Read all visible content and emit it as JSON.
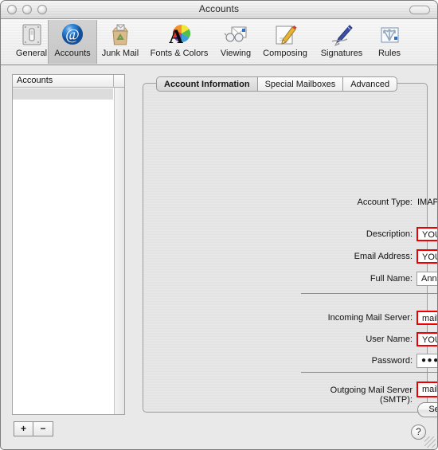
{
  "window": {
    "title": "Accounts",
    "close_icon": "close-button",
    "minimize_icon": "minimize-button",
    "zoom_icon": "zoom-button",
    "toolbar_toggle_icon": "toolbar-toggle-pill"
  },
  "toolbar": {
    "items": [
      {
        "label": "General",
        "icon": "general-switch-icon",
        "selected": false
      },
      {
        "label": "Accounts",
        "icon": "at-sign-icon",
        "selected": true
      },
      {
        "label": "Junk Mail",
        "icon": "junk-bag-icon",
        "selected": false
      },
      {
        "label": "Fonts & Colors",
        "icon": "fonts-colors-icon",
        "selected": false
      },
      {
        "label": "Viewing",
        "icon": "viewing-glasses-icon",
        "selected": false
      },
      {
        "label": "Composing",
        "icon": "composing-pencil-icon",
        "selected": false
      },
      {
        "label": "Signatures",
        "icon": "signature-pen-icon",
        "selected": false
      },
      {
        "label": "Rules",
        "icon": "rules-arrows-icon",
        "selected": false
      }
    ]
  },
  "sidebar": {
    "header": "Accounts",
    "rows": [
      {
        "label": "",
        "selected": true
      }
    ],
    "add_label": "+",
    "remove_label": "−"
  },
  "tabs": [
    {
      "label": "Account Information",
      "selected": true
    },
    {
      "label": "Special Mailboxes",
      "selected": false
    },
    {
      "label": "Advanced",
      "selected": false
    }
  ],
  "form": {
    "account_type_label": "Account Type:",
    "account_type_value": "IMAP",
    "description_label": "Description:",
    "description_value": "YOUR EMAIL ACCOUNT",
    "email_label": "Email Address:",
    "email_value": "YOUR EMAIL ACCOUNT",
    "full_name_label": "Full Name:",
    "full_name_value": "Ann Person",
    "incoming_label": "Incoming Mail Server:",
    "incoming_value": "mail.computersolutions.cn",
    "user_name_label": "User Name:",
    "user_name_value": "YOUR EMAIL ACCOUNT",
    "password_label": "Password:",
    "password_value": "●●●●●●",
    "smtp_label": "Outgoing Mail Server (SMTP):",
    "smtp_value": "mail.computersolutions.cn",
    "server_settings_label": "Server Settings..."
  },
  "help": {
    "label": "?"
  },
  "colors": {
    "highlight_red": "#ee0000",
    "window_bg": "#e9e9e9",
    "panel_bg": "#e8e8e8",
    "accent_blue": "#1b63b4"
  }
}
